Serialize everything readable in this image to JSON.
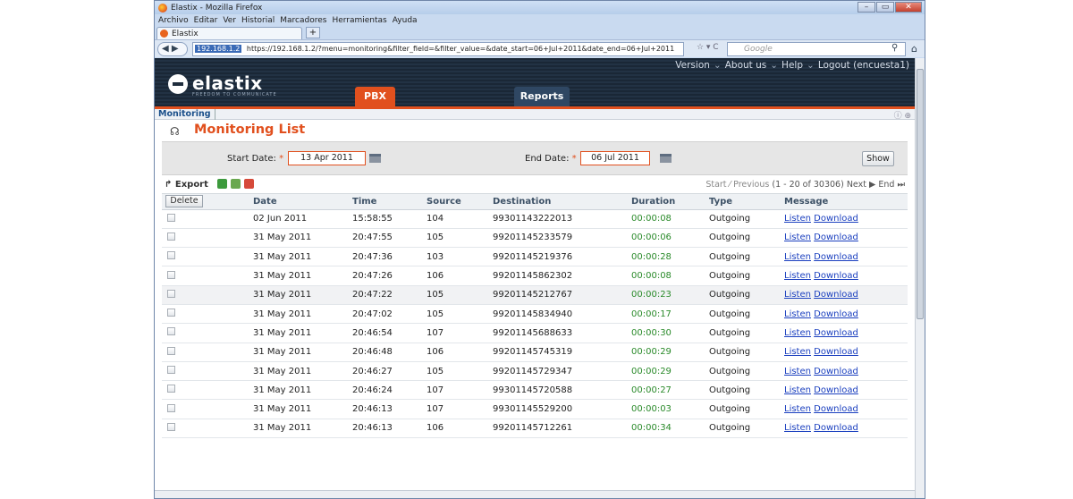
{
  "browser": {
    "window_title": "Elastix - Mozilla Firefox",
    "menu": [
      "Archivo",
      "Editar",
      "Ver",
      "Historial",
      "Marcadores",
      "Herramientas",
      "Ayuda"
    ],
    "tab_title": "Elastix",
    "new_tab": "+",
    "url_host": "192.168.1.2",
    "url": "https://192.168.1.2/?menu=monitoring&filter_field=&filter_value=&date_start=06+Jul+2011&date_end=06+Jul+2011",
    "search_placeholder": "Google"
  },
  "header": {
    "logo": "elastix",
    "logo_tagline": "FREEDOM TO COMMUNICATE",
    "links": [
      "Version",
      "About us",
      "Help",
      "Logout (encuesta1)"
    ],
    "tabs": [
      "PBX",
      "Reports"
    ]
  },
  "submenu": {
    "active": "Monitoring"
  },
  "page": {
    "title": "Monitoring List"
  },
  "filter": {
    "start_label": "Start Date:",
    "start_value": "13 Apr 2011",
    "end_label": "End Date:",
    "end_value": "06 Jul 2011",
    "required_mark": "*",
    "show_button": "Show"
  },
  "toolbar": {
    "export_label": "Export",
    "pager_start": "Start",
    "pager_previous": "Previous",
    "pager_range": "(1 - 20 of 30306)",
    "pager_next": "Next",
    "pager_end": "End"
  },
  "table": {
    "delete_button": "Delete",
    "columns": [
      "Date",
      "Time",
      "Source",
      "Destination",
      "Duration",
      "Type",
      "Message"
    ],
    "listen_label": "Listen",
    "download_label": "Download",
    "rows": [
      {
        "date": "02 Jun 2011",
        "time": "15:58:55",
        "source": "104",
        "destination": "99301143222013",
        "duration": "00:00:08",
        "type": "Outgoing"
      },
      {
        "date": "31 May 2011",
        "time": "20:47:55",
        "source": "105",
        "destination": "99201145233579",
        "duration": "00:00:06",
        "type": "Outgoing"
      },
      {
        "date": "31 May 2011",
        "time": "20:47:36",
        "source": "103",
        "destination": "99201145219376",
        "duration": "00:00:28",
        "type": "Outgoing"
      },
      {
        "date": "31 May 2011",
        "time": "20:47:26",
        "source": "106",
        "destination": "99201145862302",
        "duration": "00:00:08",
        "type": "Outgoing"
      },
      {
        "date": "31 May 2011",
        "time": "20:47:22",
        "source": "105",
        "destination": "99201145212767",
        "duration": "00:00:23",
        "type": "Outgoing"
      },
      {
        "date": "31 May 2011",
        "time": "20:47:02",
        "source": "105",
        "destination": "99201145834940",
        "duration": "00:00:17",
        "type": "Outgoing"
      },
      {
        "date": "31 May 2011",
        "time": "20:46:54",
        "source": "107",
        "destination": "99201145688633",
        "duration": "00:00:30",
        "type": "Outgoing"
      },
      {
        "date": "31 May 2011",
        "time": "20:46:48",
        "source": "106",
        "destination": "99201145745319",
        "duration": "00:00:29",
        "type": "Outgoing"
      },
      {
        "date": "31 May 2011",
        "time": "20:46:27",
        "source": "105",
        "destination": "99201145729347",
        "duration": "00:00:29",
        "type": "Outgoing"
      },
      {
        "date": "31 May 2011",
        "time": "20:46:24",
        "source": "107",
        "destination": "99301145720588",
        "duration": "00:00:27",
        "type": "Outgoing"
      },
      {
        "date": "31 May 2011",
        "time": "20:46:13",
        "source": "107",
        "destination": "99301145529200",
        "duration": "00:00:03",
        "type": "Outgoing"
      },
      {
        "date": "31 May 2011",
        "time": "20:46:13",
        "source": "106",
        "destination": "99201145712261",
        "duration": "00:00:34",
        "type": "Outgoing"
      }
    ]
  }
}
